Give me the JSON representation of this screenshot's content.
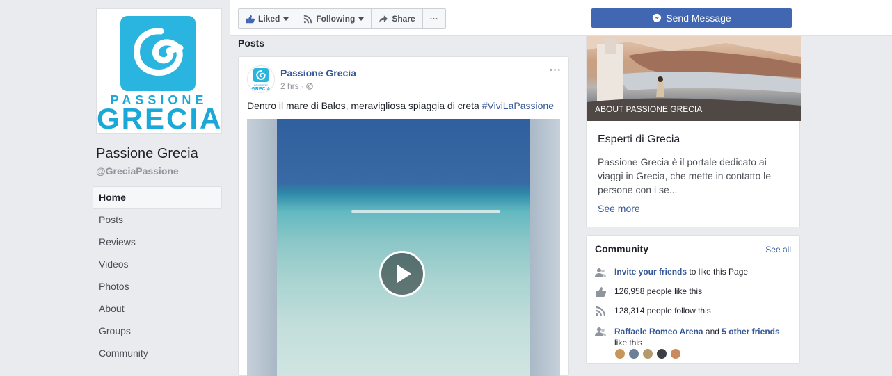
{
  "page": {
    "logo_text_top": "PASSIONE",
    "logo_text_bottom": "GRECIA",
    "name": "Passione Grecia",
    "handle": "@GreciaPassione"
  },
  "nav": {
    "items": [
      {
        "label": "Home",
        "active": true
      },
      {
        "label": "Posts"
      },
      {
        "label": "Reviews"
      },
      {
        "label": "Videos"
      },
      {
        "label": "Photos"
      },
      {
        "label": "About"
      },
      {
        "label": "Groups"
      },
      {
        "label": "Community"
      }
    ]
  },
  "toolbar": {
    "liked": "Liked",
    "following": "Following",
    "share": "Share",
    "more": "···",
    "send_message": "Send Message"
  },
  "posts": {
    "section_label": "Posts",
    "post": {
      "author": "Passione Grecia",
      "time": "2 hrs · ",
      "more": "···",
      "text": "Dentro il mare di Balos, meravigliosa spiaggia di creta ",
      "hashtag": "#ViviLaPassione",
      "avatar_text_top": "PASSIONE",
      "avatar_text_bottom": "GRECIA"
    }
  },
  "about": {
    "image_label": "ABOUT PASSIONE GRECIA",
    "title": "Esperti di Grecia",
    "description": "Passione Grecia è il portale dedicato ai viaggi in Grecia, che mette in contatto le persone con i se...",
    "see_more": "See more"
  },
  "community": {
    "title": "Community",
    "see_all": "See all",
    "invite_link": "Invite your friends",
    "invite_rest": " to like this Page",
    "likes": "126,958 people like this",
    "follows": "128,314 people follow this",
    "friend_name": "Raffaele Romeo Arena",
    "friend_and": " and ",
    "friend_others": "5 other friends",
    "friend_tail": "like this",
    "friend_avatar_colors": [
      "#c9965a",
      "#6b7f96",
      "#b49b6c",
      "#3a3f45",
      "#c98a5e"
    ]
  },
  "colors": {
    "brand_blue": "#4267b2",
    "link": "#365899",
    "logo_cyan": "#29b5e0"
  }
}
